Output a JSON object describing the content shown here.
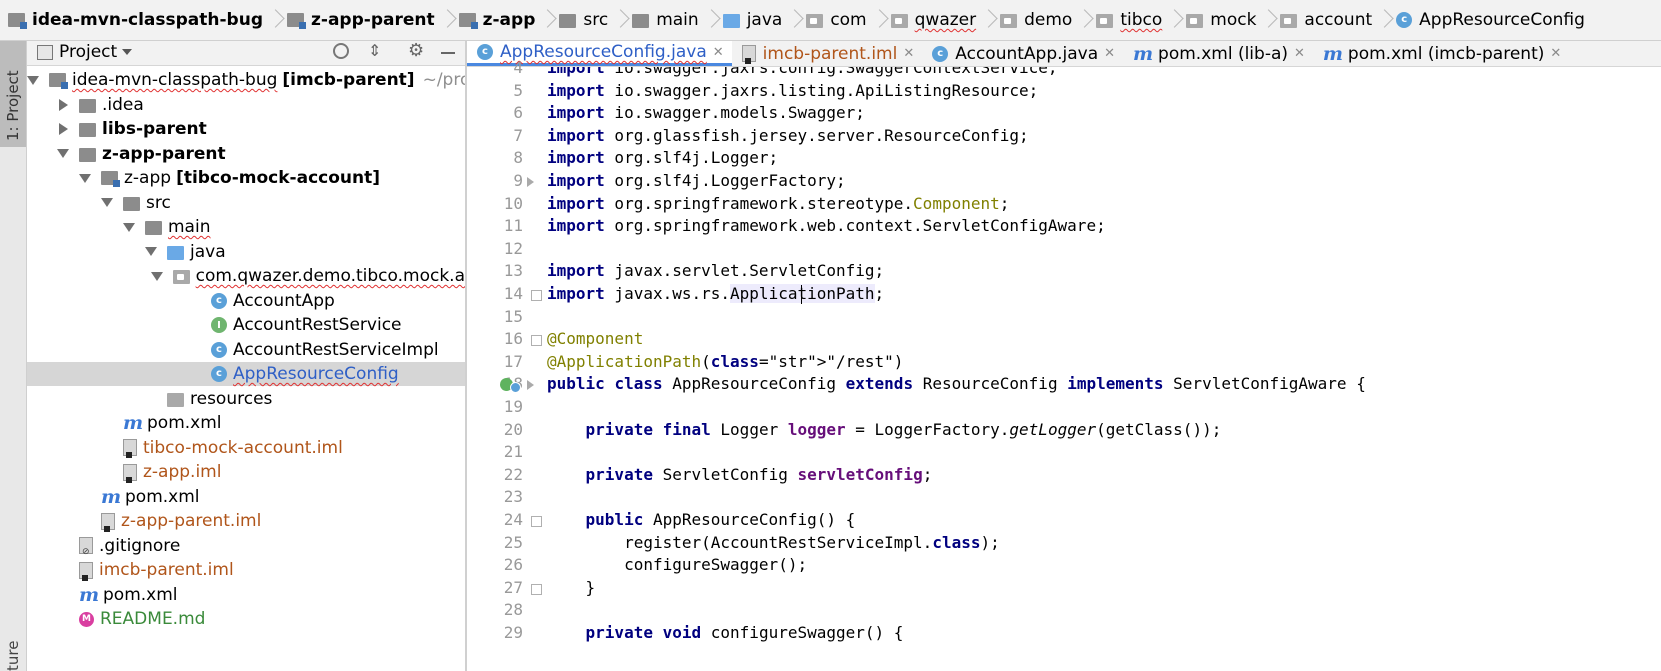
{
  "breadcrumb": [
    {
      "label": "idea-mvn-classpath-bug",
      "icon": "module-icon",
      "bold": true
    },
    {
      "label": "z-app-parent",
      "icon": "module-icon",
      "bold": true
    },
    {
      "label": "z-app",
      "icon": "module-icon",
      "bold": true
    },
    {
      "label": "src",
      "icon": "folder-icon",
      "bold": false
    },
    {
      "label": "main",
      "icon": "folder-icon",
      "bold": false
    },
    {
      "label": "java",
      "icon": "source-folder-icon",
      "bold": false
    },
    {
      "label": "com",
      "icon": "package-icon",
      "bold": false
    },
    {
      "label": "qwazer",
      "icon": "package-icon",
      "bold": false
    },
    {
      "label": "demo",
      "icon": "package-icon",
      "bold": false
    },
    {
      "label": "tibco",
      "icon": "package-icon",
      "bold": false
    },
    {
      "label": "mock",
      "icon": "package-icon",
      "bold": false
    },
    {
      "label": "account",
      "icon": "package-icon",
      "bold": false
    },
    {
      "label": "AppResourceConfig",
      "icon": "class-icon",
      "bold": false
    }
  ],
  "left_strip": {
    "project_label": "1: Project",
    "structure_label": "ture"
  },
  "project_panel": {
    "title": "Project",
    "tree": [
      {
        "depth": 0,
        "arrow": "open",
        "icon": "module",
        "label": "idea-mvn-classpath-bug",
        "extra": "[imcb-parent]",
        "suffix": "~/pro"
      },
      {
        "depth": 1,
        "arrow": "closed",
        "icon": "folder",
        "label": ".idea"
      },
      {
        "depth": 1,
        "arrow": "closed",
        "icon": "folder",
        "label": "libs-parent",
        "bold": true
      },
      {
        "depth": 1,
        "arrow": "open",
        "icon": "folder",
        "label": "z-app-parent",
        "bold": true
      },
      {
        "depth": 2,
        "arrow": "open",
        "icon": "module",
        "label": "z-app",
        "extra": "[tibco-mock-account]"
      },
      {
        "depth": 3,
        "arrow": "open",
        "icon": "folder",
        "label": "src"
      },
      {
        "depth": 4,
        "arrow": "open",
        "icon": "folder",
        "label": "main"
      },
      {
        "depth": 5,
        "arrow": "open",
        "icon": "source-folder",
        "label": "java"
      },
      {
        "depth": 6,
        "arrow": "open",
        "icon": "package",
        "label": "com.qwazer.demo.tibco.mock.a"
      },
      {
        "depth": 7,
        "arrow": "none",
        "icon": "class-runnable",
        "label": "AccountApp"
      },
      {
        "depth": 7,
        "arrow": "none",
        "icon": "interface",
        "label": "AccountRestService"
      },
      {
        "depth": 7,
        "arrow": "none",
        "icon": "class",
        "label": "AccountRestServiceImpl"
      },
      {
        "depth": 7,
        "arrow": "none",
        "icon": "class",
        "label": "AppResourceConfig",
        "selected": true
      },
      {
        "depth": 5,
        "arrow": "none",
        "icon": "resources-folder",
        "label": "resources"
      },
      {
        "depth": 3,
        "arrow": "none",
        "icon": "maven",
        "label": "pom.xml"
      },
      {
        "depth": 3,
        "arrow": "none",
        "icon": "iml",
        "label": "tibco-mock-account.iml",
        "orange": true
      },
      {
        "depth": 3,
        "arrow": "none",
        "icon": "iml",
        "label": "z-app.iml",
        "orange": true
      },
      {
        "depth": 2,
        "arrow": "none",
        "icon": "maven",
        "label": "pom.xml"
      },
      {
        "depth": 2,
        "arrow": "none",
        "icon": "iml",
        "label": "z-app-parent.iml",
        "orange": true
      },
      {
        "depth": 1,
        "arrow": "none",
        "icon": "gitignore",
        "label": ".gitignore"
      },
      {
        "depth": 1,
        "arrow": "none",
        "icon": "iml",
        "label": "imcb-parent.iml",
        "orange": true
      },
      {
        "depth": 1,
        "arrow": "none",
        "icon": "maven",
        "label": "pom.xml"
      },
      {
        "depth": 1,
        "arrow": "none",
        "icon": "markdown",
        "label": "README.md",
        "green": true
      }
    ]
  },
  "tabs": [
    {
      "label": "AppResourceConfig.java",
      "icon": "class",
      "active": true
    },
    {
      "label": "imcb-parent.iml",
      "icon": "iml",
      "orange": true
    },
    {
      "label": "AccountApp.java",
      "icon": "class-runnable"
    },
    {
      "label": "pom.xml (lib-a)",
      "icon": "maven"
    },
    {
      "label": "pom.xml (imcb-parent)",
      "icon": "maven"
    }
  ],
  "code_lines": [
    {
      "n": "4",
      "text": "import io.swagger.jaxrs.config.SwaggerContextService;"
    },
    {
      "n": "5",
      "text": "import io.swagger.jaxrs.listing.ApiListingResource;"
    },
    {
      "n": "6",
      "text": "import io.swagger.models.Swagger;"
    },
    {
      "n": "7",
      "text": "import org.glassfish.jersey.server.ResourceConfig;"
    },
    {
      "n": "8",
      "text": "import org.slf4j.Logger;"
    },
    {
      "n": "9",
      "text": "import org.slf4j.LoggerFactory;"
    },
    {
      "n": "10",
      "text": "import org.springframework.stereotype.Component;"
    },
    {
      "n": "11",
      "text": "import org.springframework.web.context.ServletConfigAware;"
    },
    {
      "n": "12",
      "text": ""
    },
    {
      "n": "13",
      "text": "import javax.servlet.ServletConfig;"
    },
    {
      "n": "14",
      "text": "import javax.ws.rs.ApplicationPath;"
    },
    {
      "n": "15",
      "text": ""
    },
    {
      "n": "16",
      "text": "@Component"
    },
    {
      "n": "17",
      "text": "@ApplicationPath(\"/rest\")"
    },
    {
      "n": "18",
      "text": "public class AppResourceConfig extends ResourceConfig implements ServletConfigAware {"
    },
    {
      "n": "19",
      "text": ""
    },
    {
      "n": "20",
      "text": "    private final Logger logger = LoggerFactory.getLogger(getClass());"
    },
    {
      "n": "21",
      "text": ""
    },
    {
      "n": "22",
      "text": "    private ServletConfig servletConfig;"
    },
    {
      "n": "23",
      "text": ""
    },
    {
      "n": "24",
      "text": "    public AppResourceConfig() {"
    },
    {
      "n": "25",
      "text": "        register(AccountRestServiceImpl.class);"
    },
    {
      "n": "26",
      "text": "        configureSwagger();"
    },
    {
      "n": "27",
      "text": "    }"
    },
    {
      "n": "28",
      "text": ""
    },
    {
      "n": "29",
      "text": "    private void configureSwagger() {"
    }
  ],
  "colors": {
    "keyword": "#00007f",
    "annotation": "#808000",
    "string": "#008000",
    "field": "#660e7a",
    "selection_text": "#2e5fc6",
    "vcs_added": "#b0551a"
  }
}
